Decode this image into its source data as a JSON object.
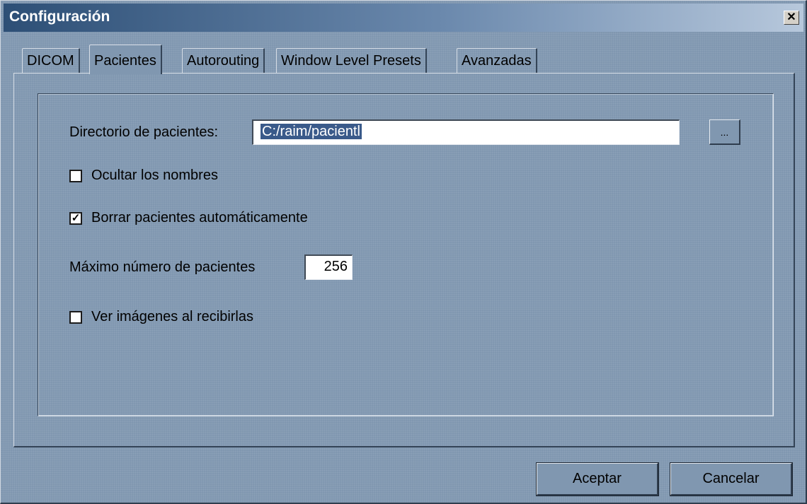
{
  "window": {
    "title": "Configuración",
    "close_glyph": "✕"
  },
  "tabs": [
    {
      "label": "DICOM",
      "active": false
    },
    {
      "label": "Pacientes",
      "active": true
    },
    {
      "label": "Autorouting",
      "active": false
    },
    {
      "label": "Window Level Presets",
      "active": false
    },
    {
      "label": "Avanzadas",
      "active": false
    }
  ],
  "patients": {
    "directory_label": "Directorio de pacientes:",
    "directory_value": "C:/raim/pacientl",
    "browse_label": "...",
    "hide_names_label": "Ocultar los nombres",
    "hide_names_checked": false,
    "auto_delete_label": "Borrar pacientes automáticamente",
    "auto_delete_checked": true,
    "check_glyph": "✓",
    "max_patients_label": "Máximo número de pacientes",
    "max_patients_value": "256",
    "view_on_receive_label": "Ver imágenes al recibirlas",
    "view_on_receive_checked": false
  },
  "buttons": {
    "accept": "Aceptar",
    "cancel": "Cancelar"
  },
  "colors": {
    "dialog_bg": "#8097b0",
    "title_start": "#2d4f76",
    "selection": "#3a5a8a"
  }
}
